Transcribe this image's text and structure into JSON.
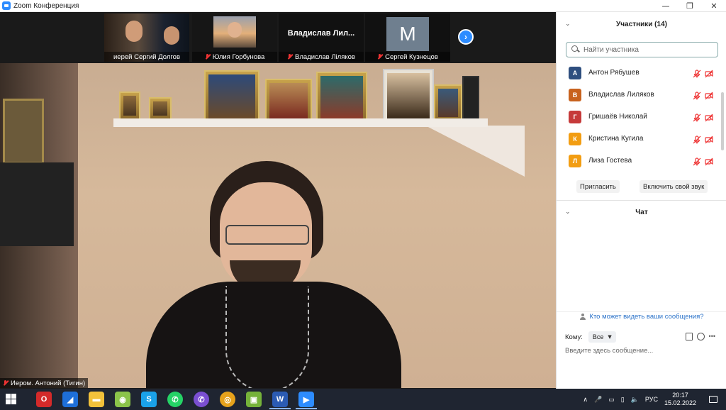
{
  "window": {
    "title": "Zoom Конференция",
    "minimize": "—",
    "maximize": "❐",
    "close": "✕"
  },
  "thumbnails": [
    {
      "name": "иерей Сергий Долгов",
      "muted": false,
      "type": "video"
    },
    {
      "name": "Юлия Горбунова",
      "muted": true,
      "type": "video"
    },
    {
      "name": "Владислав Ліляков",
      "title": "Владислав  Лил...",
      "muted": true,
      "type": "title"
    },
    {
      "name": "Сергей Кузнецов",
      "muted": true,
      "type": "avatar",
      "initial": "M"
    }
  ],
  "next_page_icon": "›",
  "main_video": {
    "name": "Иером. Антоний (Тигин)"
  },
  "participants_panel": {
    "title": "Участники (14)",
    "search_placeholder": "Найти участника",
    "items": [
      {
        "initial": "А",
        "name": "Антон Рябушев",
        "color": "#2f4f7f"
      },
      {
        "initial": "В",
        "name": "Владислав Лиляков",
        "color": "#c8621e"
      },
      {
        "initial": "Г",
        "name": "Гришаёв Николай",
        "color": "#c63a3a"
      },
      {
        "initial": "К",
        "name": "Кристина Кугила",
        "color": "#f29d12"
      },
      {
        "initial": "Л",
        "name": "Лиза Гостева",
        "color": "#f29d12"
      }
    ],
    "invite_label": "Пригласить",
    "unmute_label": "Включить свой звук"
  },
  "chat_panel": {
    "title": "Чат",
    "visibility_note": "Кто может видеть ваши сообщения?",
    "to_label": "Кому:",
    "to_value": "Все",
    "message_placeholder": "Введите здесь сообщение..."
  },
  "taskbar": {
    "apps": [
      {
        "label": "O",
        "color": "#d42a2a"
      },
      {
        "label": "◢",
        "color": "#1e6fd9"
      },
      {
        "label": "▬",
        "color": "#f2c13a"
      },
      {
        "label": "◉",
        "color": "#8bc34a"
      },
      {
        "label": "S",
        "color": "#1aa1e8"
      },
      {
        "label": "✆",
        "color": "#25d366"
      },
      {
        "label": "✆",
        "color": "#7a4fd1"
      },
      {
        "label": "◎",
        "color": "#e6a21b"
      },
      {
        "label": "▣",
        "color": "#75b23a"
      },
      {
        "label": "W",
        "color": "#2b5bb3"
      },
      {
        "label": "▶",
        "color": "#2d8cff"
      }
    ],
    "tray": {
      "caret": "∧",
      "lang": "РУС",
      "time": "20:17",
      "date": "15.02.2022"
    }
  },
  "colors": {
    "accent": "#2d8cff",
    "muted_red": "#e33333"
  }
}
